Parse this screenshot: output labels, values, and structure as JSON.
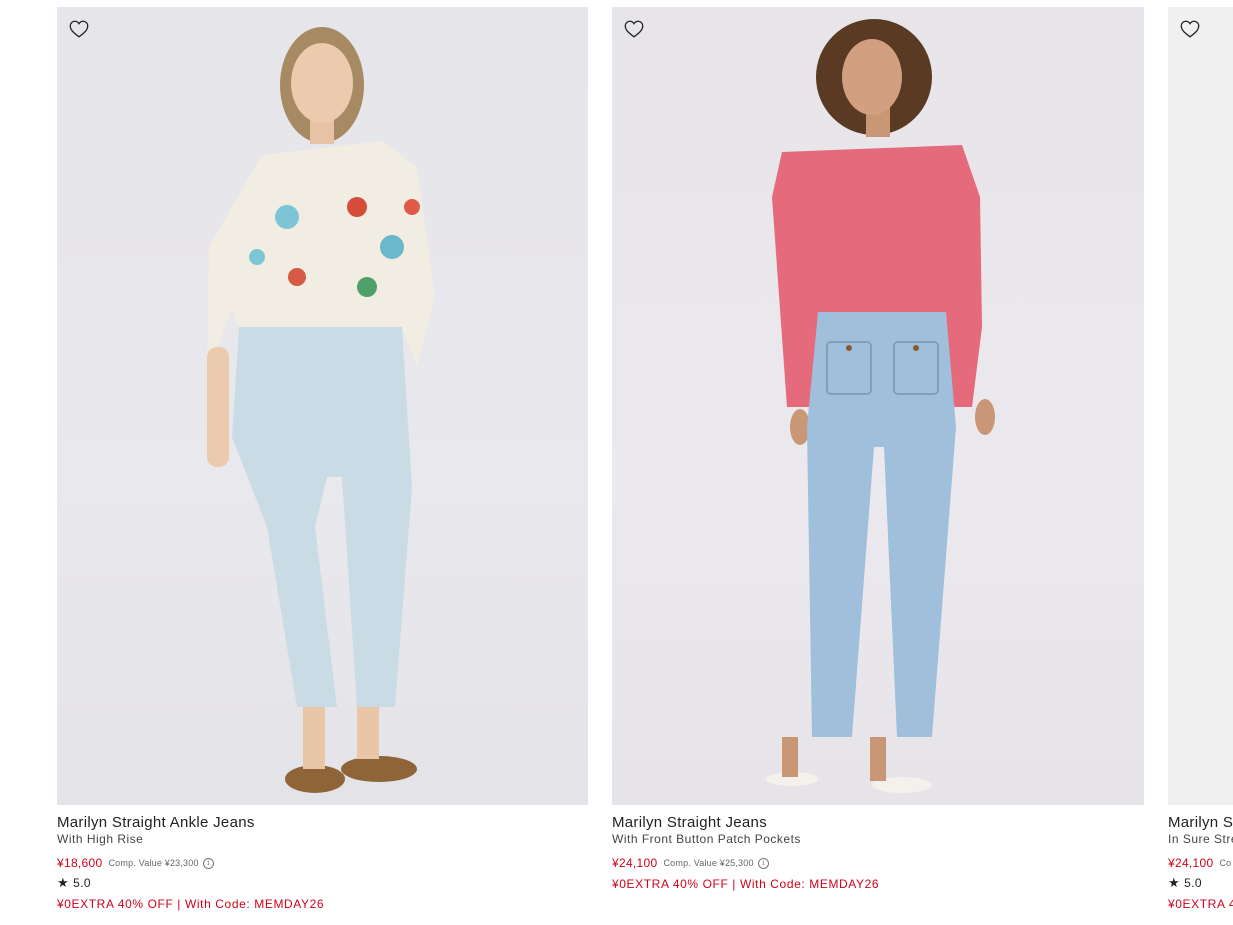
{
  "products": [
    {
      "name": "Marilyn Straight Ankle Jeans",
      "subtitle": "With High Rise",
      "price": "¥18,600",
      "comp_value": "Comp. Value ¥23,300",
      "rating": "5.0",
      "promo": "¥0EXTRA 40% OFF | With Code: MEMDAY26",
      "image_alt": "Model in floral crab-print blouse, light wash ankle jeans and tan loafers",
      "shirt_color": "#f2ede3",
      "jeans_color": "#c9dbe5"
    },
    {
      "name": "Marilyn Straight Jeans",
      "subtitle": "With Front Button Patch Pockets",
      "price": "¥24,100",
      "comp_value": "Comp. Value ¥25,300",
      "rating": "",
      "promo": "¥0EXTRA 40% OFF | With Code: MEMDAY26",
      "image_alt": "Model in pink long-sleeve top and medium wash straight jeans with patch pockets",
      "shirt_color": "#e46a7c",
      "jeans_color": "#9fbfdc"
    },
    {
      "name": "Marilyn S",
      "subtitle": "In Sure Stre",
      "price": "¥24,100",
      "comp_value": "Co",
      "rating": "5.0",
      "promo": "¥0EXTRA 4",
      "image_alt": "Product image partially visible"
    }
  ],
  "icons": {
    "favorite": "heart-outline-icon",
    "info": "info-icon",
    "star": "star-icon"
  },
  "colors": {
    "sale_red": "#d0021b",
    "text": "#222222",
    "image_bg": "#e8e7eb"
  }
}
